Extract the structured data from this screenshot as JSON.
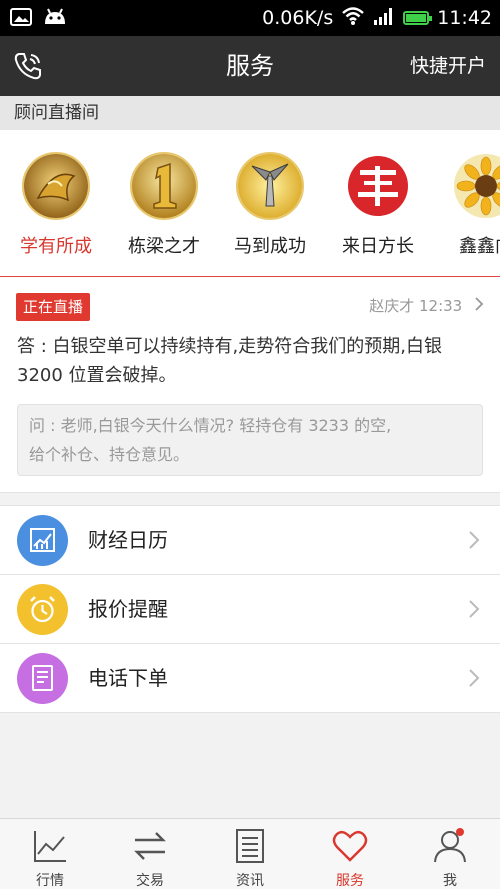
{
  "status_bar": {
    "speed": "0.06K/s",
    "time": "11:42"
  },
  "header": {
    "title": "服务",
    "right_action": "快捷开户",
    "phone_icon": "phone-icon"
  },
  "section": {
    "title": "顾问直播间"
  },
  "advisors": [
    {
      "name": "学有所成",
      "active": true
    },
    {
      "name": "栋梁之才",
      "active": false
    },
    {
      "name": "马到成功",
      "active": false
    },
    {
      "name": "来日方长",
      "active": false
    },
    {
      "name": "鑫鑫向",
      "active": false
    }
  ],
  "live": {
    "badge": "正在直播",
    "author": "赵庆才",
    "time": "12:33",
    "answer_line1": "答 : 白银空单可以持续持有,走势符合我们的预期,白银",
    "answer_line2": "3200 位置会破掉。",
    "question_line1": "问 : 老师,白银今天什么情况? 轻持仓有 3233 的空,",
    "question_line2": "给个补仓、持仓意见。"
  },
  "menu": [
    {
      "label": "财经日历",
      "icon": "calendar-chart-icon",
      "color": "#4a8fe0"
    },
    {
      "label": "报价提醒",
      "icon": "alarm-clock-icon",
      "color": "#f3c12d"
    },
    {
      "label": "电话下单",
      "icon": "document-order-icon",
      "color": "#c56fe3"
    }
  ],
  "tabs": [
    {
      "label": "行情",
      "icon": "chart-line-icon"
    },
    {
      "label": "交易",
      "icon": "exchange-arrows-icon"
    },
    {
      "label": "资讯",
      "icon": "news-doc-icon"
    },
    {
      "label": "服务",
      "icon": "heart-icon",
      "active": true
    },
    {
      "label": "我",
      "icon": "user-icon"
    }
  ],
  "colors": {
    "accent": "#d9382e",
    "header_bg": "#303030"
  }
}
